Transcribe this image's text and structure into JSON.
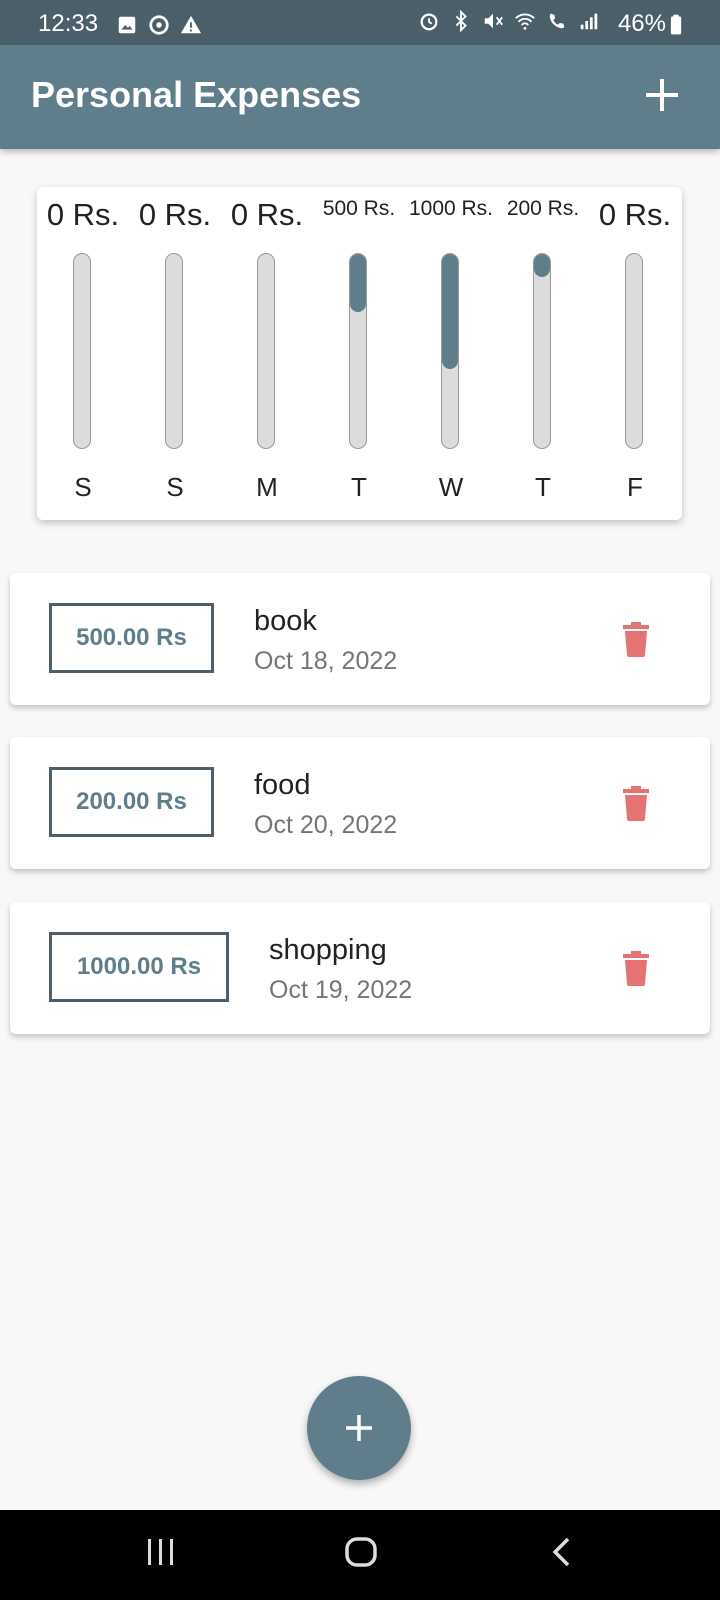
{
  "status_bar": {
    "time": "12:33",
    "battery": "46%"
  },
  "app_bar": {
    "title": "Personal Expenses",
    "add_icon": "plus-icon"
  },
  "chart_data": {
    "type": "bar",
    "categories": [
      "S",
      "S",
      "M",
      "T",
      "W",
      "T",
      "F"
    ],
    "labels": [
      "0 Rs.",
      "0 Rs.",
      "0 Rs.",
      "500 Rs.",
      "1000 Rs.",
      "200 Rs.",
      "0 Rs."
    ],
    "values": [
      0,
      0,
      0,
      500,
      1000,
      200,
      0
    ],
    "fill_fractions": [
      0,
      0,
      0,
      0.2941,
      0.5882,
      0.1176,
      0
    ],
    "orientation": "vertical",
    "bar_color": "#607d8b"
  },
  "expenses": [
    {
      "amount": "500.00 Rs",
      "title": "book",
      "date": "Oct 18, 2022"
    },
    {
      "amount": "200.00 Rs",
      "title": "food",
      "date": "Oct 20, 2022"
    },
    {
      "amount": "1000.00 Rs",
      "title": "shopping",
      "date": "Oct 19, 2022"
    }
  ],
  "colors": {
    "primary": "#607d8b",
    "status_bar": "#4a5f6a",
    "delete": "#e57373",
    "amount_border": "#4f5f69"
  },
  "fab": {
    "icon": "plus-icon"
  }
}
